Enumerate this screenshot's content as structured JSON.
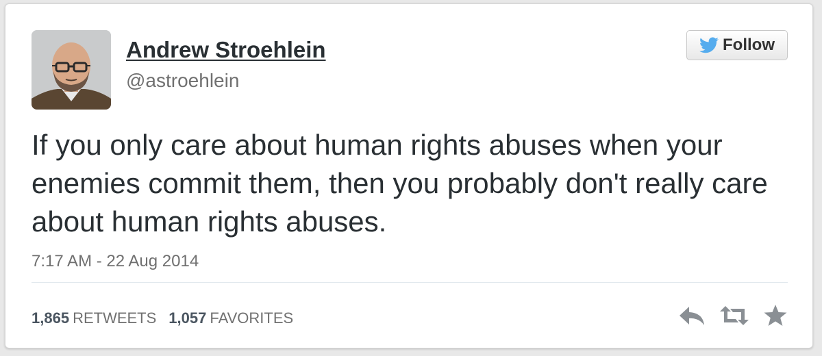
{
  "author": {
    "name": "Andrew Stroehlein",
    "handle": "@astroehlein"
  },
  "follow_button": {
    "label": "Follow",
    "icon": "twitter-bird-icon",
    "icon_color": "#55acee"
  },
  "tweet": {
    "text": "If you only care about human rights abuses when your enemies commit them, then you probably don't really care about human rights abuses.",
    "timestamp": "7:17 AM - 22 Aug 2014"
  },
  "stats": {
    "retweets_count": "1,865",
    "retweets_label": "RETWEETS",
    "favorites_count": "1,057",
    "favorites_label": "FAVORITES"
  },
  "actions": [
    {
      "icon": "reply-icon"
    },
    {
      "icon": "retweet-icon"
    },
    {
      "icon": "favorite-star-icon"
    }
  ],
  "colors": {
    "text": "#292f33",
    "muted": "#707070",
    "action_icons": "#8a8f94"
  }
}
